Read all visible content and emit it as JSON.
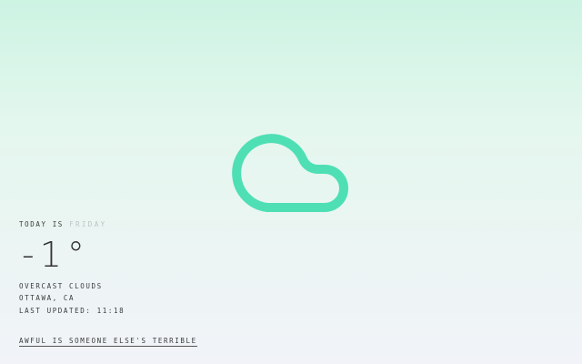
{
  "weather": {
    "icon": "cloud-icon",
    "icon_color": "#4fdfb4",
    "today_prefix": "TODAY IS",
    "day": "FRIDAY",
    "temperature": "-1°",
    "conditions": "OVERCAST CLOUDS",
    "location": "OTTAWA, CA",
    "last_updated_label": "LAST UPDATED:",
    "last_updated_time": "11:18"
  },
  "footer": {
    "quote_link": "AWFUL IS SOMEONE ELSE'S TERRIBLE"
  }
}
